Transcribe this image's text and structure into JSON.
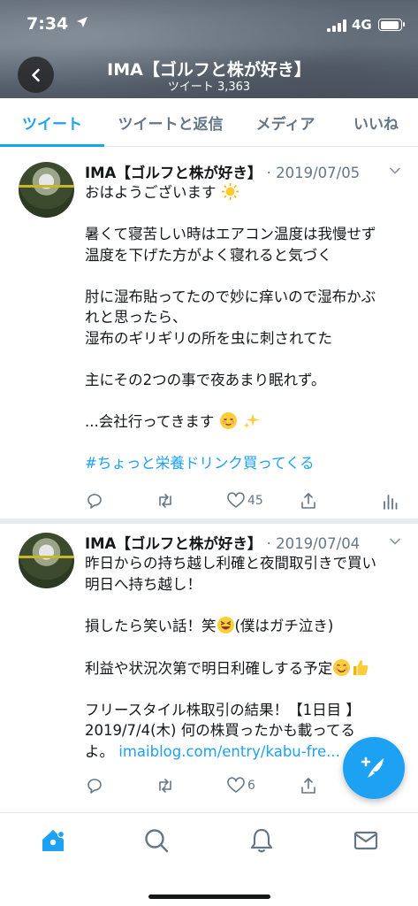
{
  "status_bar": {
    "time": "7:34",
    "network": "4G"
  },
  "profile": {
    "name": "IMA【ゴルフと株が好き】",
    "tweet_count": "ツイート 3,363"
  },
  "tabs": [
    {
      "label": "ツイート",
      "active": true
    },
    {
      "label": "ツイートと返信",
      "active": false
    },
    {
      "label": "メディア",
      "active": false
    },
    {
      "label": "いいね",
      "active": false
    }
  ],
  "tweets": [
    {
      "author": "IMA【ゴルフと株が好き】",
      "date": "· 2019/07/05",
      "lines": [
        "おはようございます",
        "",
        "暑くて寝苦しい時はエアコン温度は我慢せず",
        "温度を下げた方がよく寝れると気づく",
        "",
        "肘に湿布貼ってたので妙に痒いので湿布かぶ",
        "れと思ったら、",
        "湿布のギリギリの所を虫に刺されてた",
        "",
        "主にその2つの事で夜あまり眠れず。",
        "",
        "...会社行ってきます"
      ],
      "hashtag": "#ちょっと栄養ドリンク買ってくる",
      "likes": "45"
    },
    {
      "author": "IMA【ゴルフと株が好き】",
      "date": "· 2019/07/04",
      "lines": [
        "昨日からの持ち越し利確と夜間取引きで買い",
        "明日へ持ち越し！",
        "",
        "損したら笑い話！笑",
        "",
        "利益や状況次第で明日利確しする予定",
        "",
        "フリースタイル株取引の結果！【1日目 】",
        "2019/7/4(木) 何の株買ったかも載ってる",
        "よ。"
      ],
      "inline_after_laugh": "(僕はガチ泣き)",
      "link": "imaiblog.com/entry/kabu-fre...",
      "likes": "6"
    }
  ],
  "colors": {
    "accent": "#1da1f2",
    "muted": "#657786",
    "text": "#14171a"
  },
  "icons": [
    "back-arrow-icon",
    "chevron-down-icon",
    "reply-icon",
    "retweet-icon",
    "heart-icon",
    "share-icon",
    "analytics-icon",
    "compose-icon",
    "home-icon",
    "search-icon",
    "bell-icon",
    "mail-icon"
  ]
}
